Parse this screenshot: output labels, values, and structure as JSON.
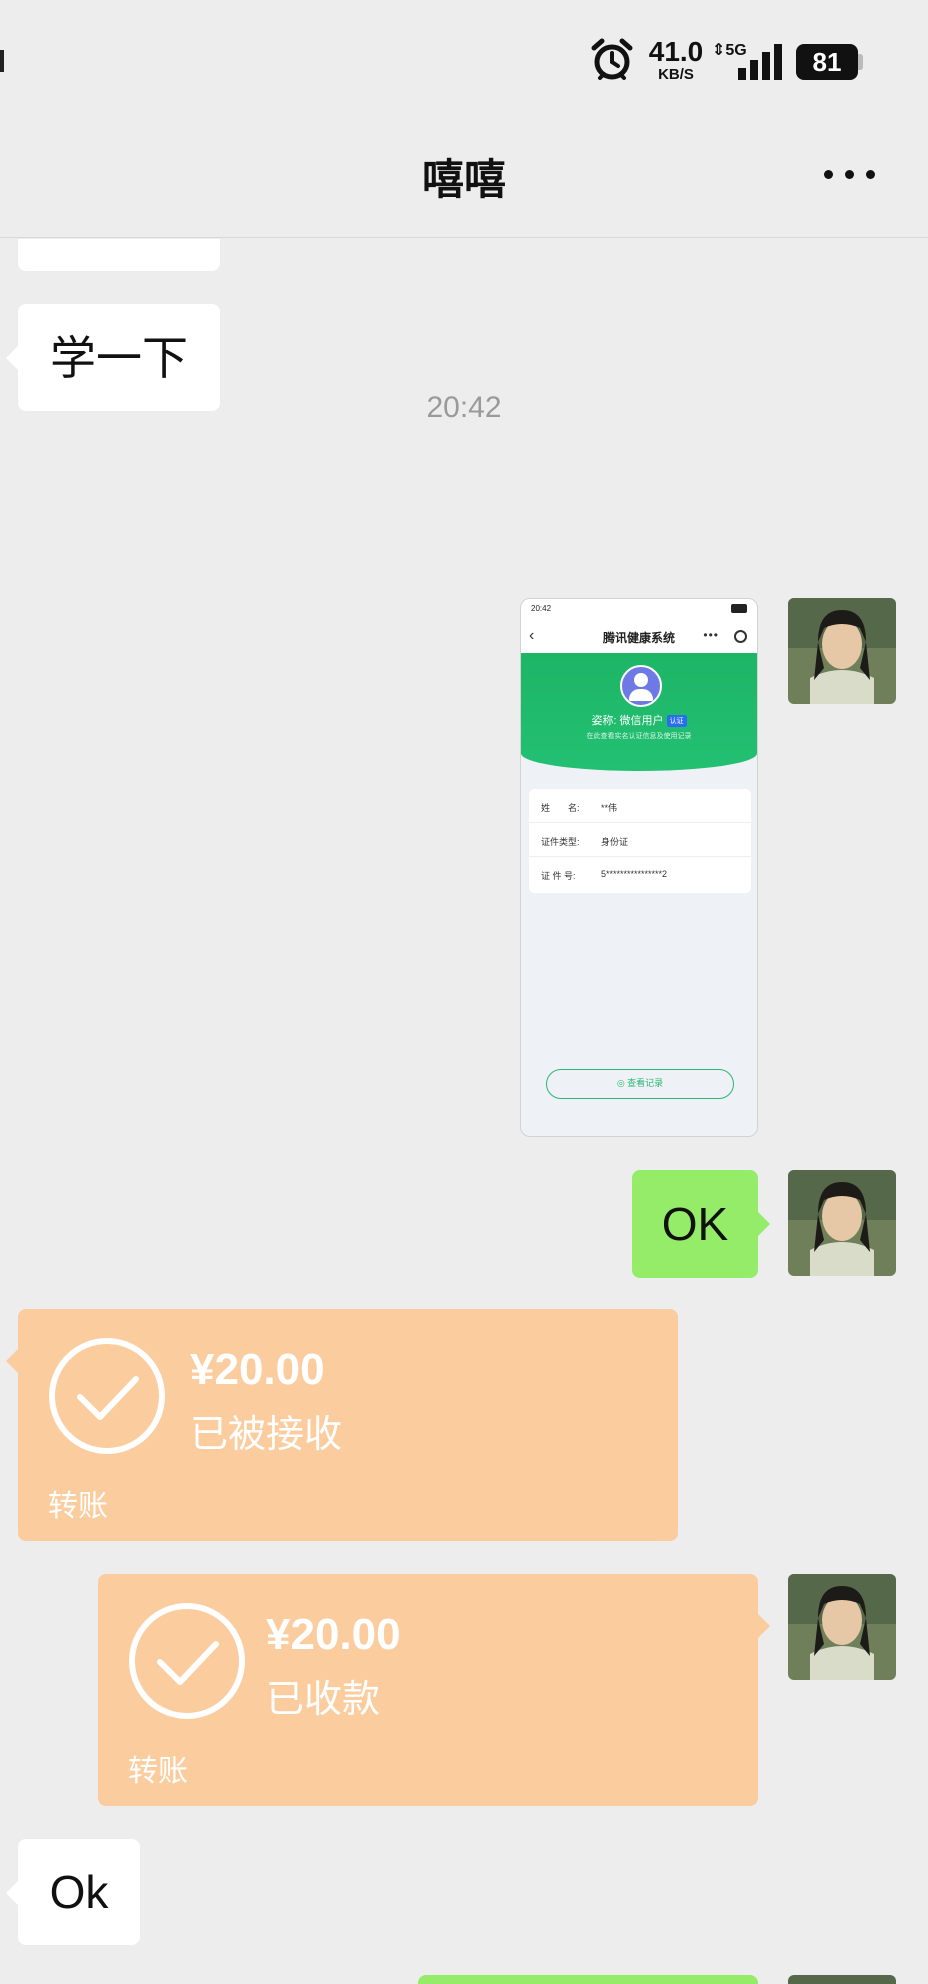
{
  "status_bar": {
    "net_speed_value": "41.0",
    "net_speed_unit": "KB/S",
    "network_type": "5G",
    "battery_level": "81"
  },
  "header": {
    "title": "嘻嘻"
  },
  "messages": {
    "m1_text": "学一下",
    "timestamp": "20:42",
    "shot": {
      "time": "20:42",
      "title": "腾讯健康系统",
      "user_label": "姿称: 微信用户",
      "user_tag": "认证",
      "note": "在此查看实名认证信息及使用记录",
      "rows": [
        {
          "key": "姓　　名:",
          "value": "**伟"
        },
        {
          "key": "证件类型:",
          "value": "身份证"
        },
        {
          "key": "证 件 号:",
          "value": "5****************2"
        }
      ],
      "button": "查看记录"
    },
    "m3_text": "OK",
    "transfer_in": {
      "amount": "¥20.00",
      "status": "已被接收",
      "footer": "转账"
    },
    "transfer_out": {
      "amount": "¥20.00",
      "status": "已收款",
      "footer": "转账"
    },
    "m6_text": "Ok"
  },
  "colors": {
    "background": "#ededed",
    "incoming_bubble": "#ffffff",
    "outgoing_bubble": "#95ec69",
    "transfer_card": "#fbcc9e",
    "mini_program_green": "#1db566"
  },
  "icons": [
    "alarm-icon",
    "signal-icon",
    "battery-icon",
    "more-icon",
    "checkmark-circle-icon"
  ]
}
